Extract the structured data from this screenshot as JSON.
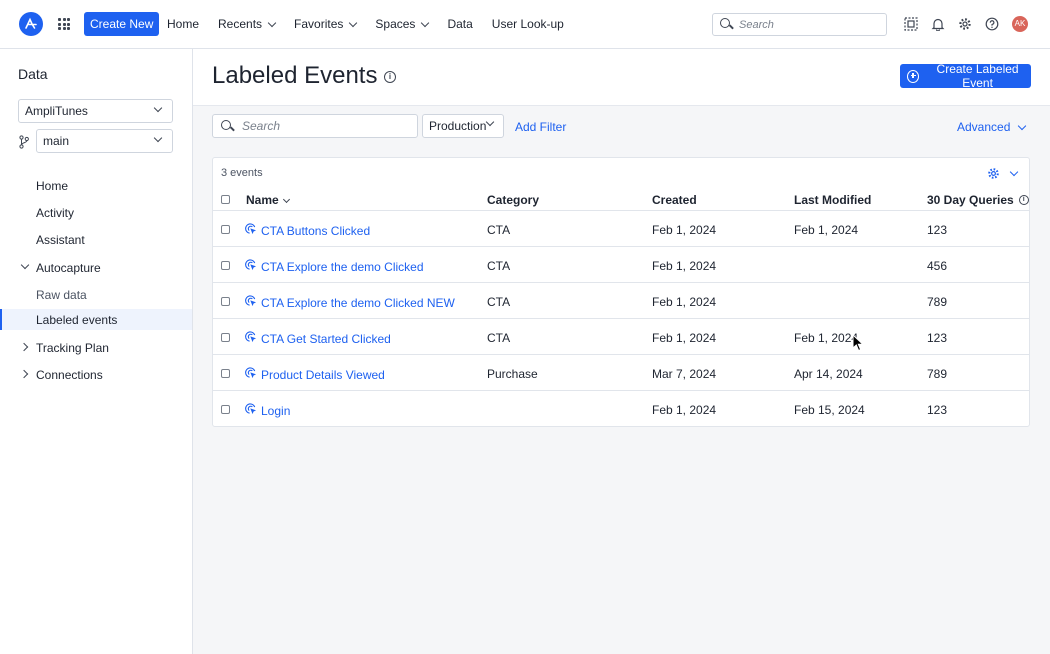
{
  "topbar": {
    "create_new_label": "Create New",
    "nav": [
      {
        "label": "Home",
        "dropdown": false
      },
      {
        "label": "Recents",
        "dropdown": true
      },
      {
        "label": "Favorites",
        "dropdown": true
      },
      {
        "label": "Spaces",
        "dropdown": true
      },
      {
        "label": "Data",
        "dropdown": false
      },
      {
        "label": "User Look-up",
        "dropdown": false
      }
    ],
    "search_placeholder": "Search",
    "icons": [
      "frame-select-icon",
      "bell-icon",
      "gear-icon",
      "help-icon"
    ],
    "avatar_initials": "AK"
  },
  "sidebar": {
    "title": "Data",
    "project_value": "AmpliTunes",
    "branch_value": "main",
    "items": [
      {
        "label": "Home"
      },
      {
        "label": "Activity"
      },
      {
        "label": "Assistant"
      },
      {
        "label": "Autocapture"
      },
      {
        "label": "Raw data"
      },
      {
        "label": "Labeled events"
      },
      {
        "label": "Tracking Plan"
      },
      {
        "label": "Connections"
      }
    ]
  },
  "main": {
    "title": "Labeled Events",
    "create_button_label": "Create Labeled Event",
    "search_placeholder": "Search",
    "environment_value": "Production",
    "add_filter_label": "Add Filter",
    "advanced_label": "Advanced",
    "event_count": "3 events",
    "columns": {
      "name": "Name",
      "category": "Category",
      "created": "Created",
      "last_modified": "Last Modified",
      "queries": "30 Day Queries"
    },
    "rows": [
      {
        "name": "CTA Buttons Clicked",
        "category": "CTA",
        "created": "Feb 1, 2024",
        "last_modified": "Feb 1, 2024",
        "queries": "123"
      },
      {
        "name": "CTA Explore the demo Clicked",
        "category": "CTA",
        "created": "Feb 1, 2024",
        "last_modified": "",
        "queries": "456"
      },
      {
        "name": "CTA Explore the demo Clicked NEW",
        "category": "CTA",
        "created": "Feb 1, 2024",
        "last_modified": "",
        "queries": "789"
      },
      {
        "name": "CTA Get Started Clicked",
        "category": "CTA",
        "created": "Feb 1, 2024",
        "last_modified": "Feb 1, 2024",
        "queries": "123"
      },
      {
        "name": "Product Details Viewed",
        "category": "Purchase",
        "created": "Mar 7, 2024",
        "last_modified": "Apr 14, 2024",
        "queries": "789"
      },
      {
        "name": "Login",
        "category": "",
        "created": "Feb 1, 2024",
        "last_modified": "Feb 15, 2024",
        "queries": "123"
      }
    ]
  },
  "colors": {
    "accent": "#1e61f0",
    "active_bg": "#eef3fd",
    "avatar": "#d9655a"
  }
}
